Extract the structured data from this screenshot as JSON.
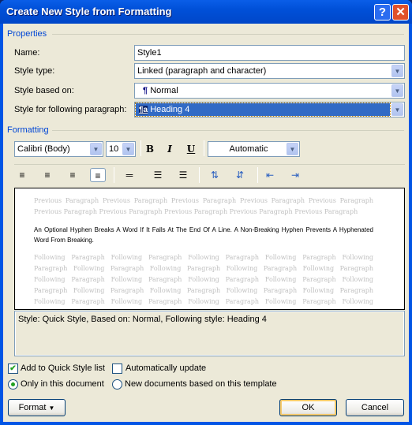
{
  "window": {
    "title": "Create New Style from Formatting",
    "help_label": "?",
    "close_label": "✕"
  },
  "properties": {
    "group_label": "Properties",
    "name_label": "Name:",
    "name_value": "Style1",
    "style_type_label": "Style type:",
    "style_type_value": "Linked (paragraph and character)",
    "based_on_label": "Style based on:",
    "based_on_icon": "¶",
    "based_on_value": "Normal",
    "following_label": "Style for following paragraph:",
    "following_icon": "¶a",
    "following_value": "Heading 4"
  },
  "formatting": {
    "group_label": "Formatting",
    "font": "Calibri (Body)",
    "size": "10",
    "bold": "B",
    "italic": "I",
    "underline": "U",
    "color": "Automatic",
    "icons": [
      "align-left-icon",
      "align-center-icon",
      "align-right-icon",
      "justify-icon",
      "single-spacing-icon",
      "one-half-spacing-icon",
      "double-spacing-icon",
      "increase-paragraph-spacing-icon",
      "decrease-paragraph-spacing-icon",
      "decrease-indent-icon",
      "increase-indent-icon"
    ],
    "active_alignment": "justify"
  },
  "preview": {
    "previous": "Previous Paragraph Previous Paragraph Previous Paragraph Previous Paragraph Previous Paragraph Previous Paragraph Previous Paragraph Previous Paragraph Previous Paragraph Previous Paragraph",
    "current": "An Optional Hyphen Breaks A Word If It Falls At The End Of A Line. A Non-Breaking Hyphen Prevents A Hyphenated Word From Breaking.",
    "following": "Following Paragraph Following Paragraph Following Paragraph Following Paragraph Following Paragraph Following Paragraph Following Paragraph Following Paragraph Following Paragraph Following Paragraph Following Paragraph Following Paragraph Following Paragraph Following Paragraph Following Paragraph Following Paragraph Following Paragraph Following Paragraph Following Paragraph Following Paragraph Following Paragraph Following Paragraph Following Paragraph Following Paragraph Following Paragraph"
  },
  "description": "Style: Quick Style, Based on: Normal, Following style: Heading 4",
  "options": {
    "add_quick_style": {
      "label": "Add to Quick Style list",
      "checked": true
    },
    "auto_update": {
      "label": "Automatically update",
      "checked": false
    },
    "only_this_doc": {
      "label": "Only in this document",
      "selected": true
    },
    "new_docs": {
      "label": "New documents based on this template",
      "selected": false
    }
  },
  "buttons": {
    "format": "Format",
    "ok": "OK",
    "cancel": "Cancel"
  }
}
